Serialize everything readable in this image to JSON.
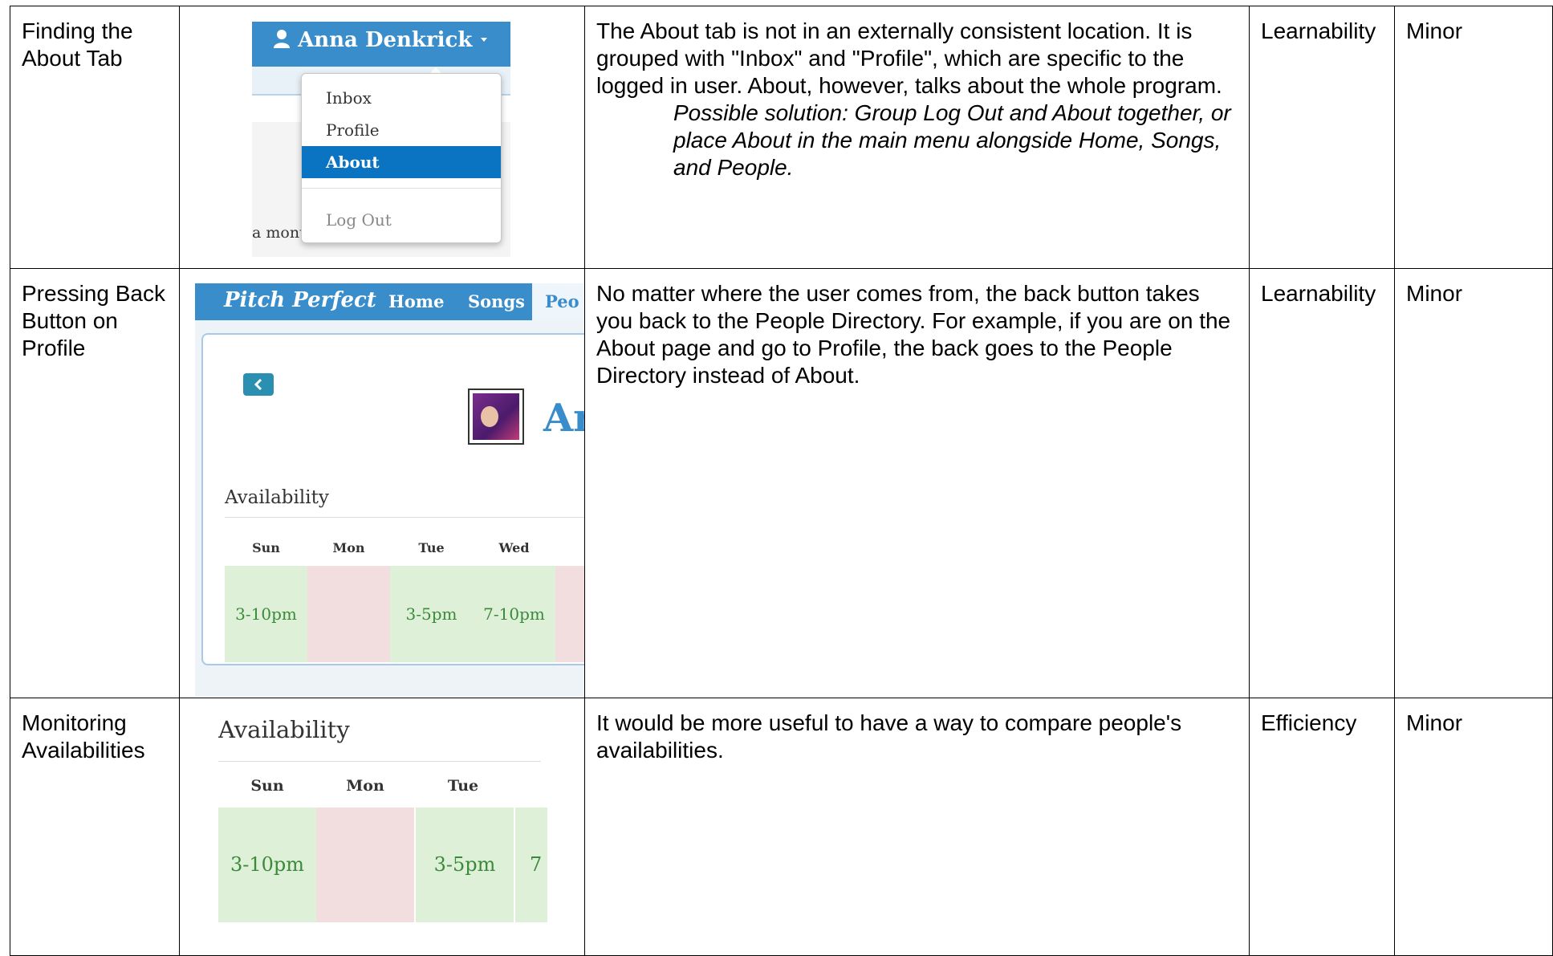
{
  "rows": [
    {
      "issue": "Finding the About Tab",
      "description": "The About tab is not in an externally consistent location.  It is grouped with \"Inbox\" and \"Profile\", which are specific to the logged in user.  About, however, talks about the whole program.",
      "solution": "Possible solution:  Group Log Out and About together, or place About in the main menu alongside Home, Songs, and People.",
      "category": "Learnability",
      "severity": "Minor",
      "screenshot": {
        "user_name": "Anna Denkrick",
        "user_icon": "user-icon",
        "menu": [
          "Inbox",
          "Profile",
          "About",
          "Log Out"
        ],
        "selected": "About",
        "peek_text": "a month! Don't forget that we",
        "accent_color": "#3a8dcb",
        "selected_color": "#0a74c2"
      }
    },
    {
      "issue": "Pressing Back Button on Profile",
      "description": "No matter where the user comes from, the back button takes you back to the People Directory.  For example, if you are on the About page and go to Profile, the back goes to the People Directory instead of About.",
      "category": "Learnability",
      "severity": "Minor",
      "screenshot": {
        "brand": "Pitch Perfect",
        "nav": [
          "Home",
          "Songs",
          "Peo"
        ],
        "back_icon": "chevron-left-icon",
        "name_peek": "Ar",
        "availability_title": "Availability",
        "days": [
          "Sun",
          "Mon",
          "Tue",
          "Wed"
        ],
        "slots": [
          "3-10pm",
          "",
          "3-5pm",
          "7-10pm"
        ],
        "available_color": "#dff0d8",
        "unavailable_color": "#f2dede"
      }
    },
    {
      "issue": "Monitoring Availabilities",
      "description": "It would be more useful to have a way to compare people's availabilities.",
      "category": "Efficiency",
      "severity": "Minor",
      "screenshot": {
        "availability_title": "Availability",
        "days": [
          "Sun",
          "Mon",
          "Tue"
        ],
        "slots": [
          "3-10pm",
          "",
          "3-5pm",
          "7"
        ]
      }
    }
  ]
}
